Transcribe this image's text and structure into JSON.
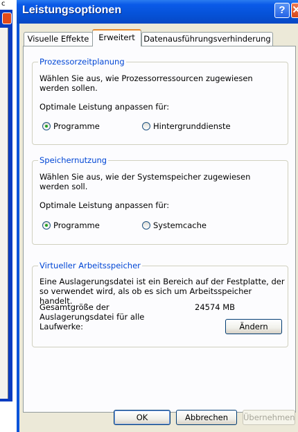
{
  "background_window": {
    "text": "c"
  },
  "dialog": {
    "title": "Leistungsoptionen",
    "help_symbol": "?",
    "close_symbol": "✕"
  },
  "tabs": [
    {
      "label": "Visuelle Effekte",
      "active": false
    },
    {
      "label": "Erweitert",
      "active": true
    },
    {
      "label": "Datenausführungsverhinderung",
      "active": false
    }
  ],
  "cpu": {
    "title": "Prozessorzeitplanung",
    "desc": "Wählen Sie aus, wie Prozessorressourcen zugewiesen werden sollen.",
    "adjust_label": "Optimale Leistung anpassen für:",
    "options": [
      {
        "label": "Programme",
        "selected": true
      },
      {
        "label": "Hintergrunddienste",
        "selected": false
      }
    ]
  },
  "memory": {
    "title": "Speichernutzung",
    "desc": "Wählen Sie aus, wie der Systemspeicher zugewiesen werden soll.",
    "adjust_label": "Optimale Leistung anpassen für:",
    "options": [
      {
        "label": "Programme",
        "selected": true
      },
      {
        "label": "Systemcache",
        "selected": false
      }
    ]
  },
  "virtual_memory": {
    "title": "Virtueller Arbeitsspeicher",
    "desc": "Eine Auslagerungsdatei ist ein Bereich auf der Festplatte, der so verwendet wird, als ob es sich um Arbeitsspeicher handelt.",
    "size_label": "Gesamtgröße der Auslagerungsdatei für alle Laufwerke:",
    "size_value": "24574 MB",
    "change_button": "Ändern"
  },
  "footer": {
    "ok": "OK",
    "cancel": "Abbrechen",
    "apply": "Übernehmen"
  },
  "colors": {
    "titlebar": "#0652d8",
    "group_title": "#0046d5",
    "active_tab_accent": "#e68b2c",
    "dialog_face": "#ece9d8"
  }
}
